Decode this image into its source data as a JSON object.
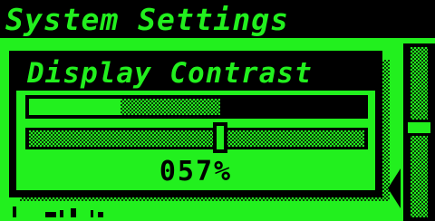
{
  "window": {
    "title": "System Settings"
  },
  "dialog": {
    "title": "Display Contrast",
    "level_fraction": 0.57,
    "value_text": "057%"
  },
  "scrollbar": {
    "position_fraction": 0.47
  },
  "icons": {
    "scroll_arrow": "triangle-left-icon"
  },
  "colors": {
    "screen_green": "#22f01e",
    "ink": "#000000",
    "dither_dark": "#0b3a08"
  }
}
